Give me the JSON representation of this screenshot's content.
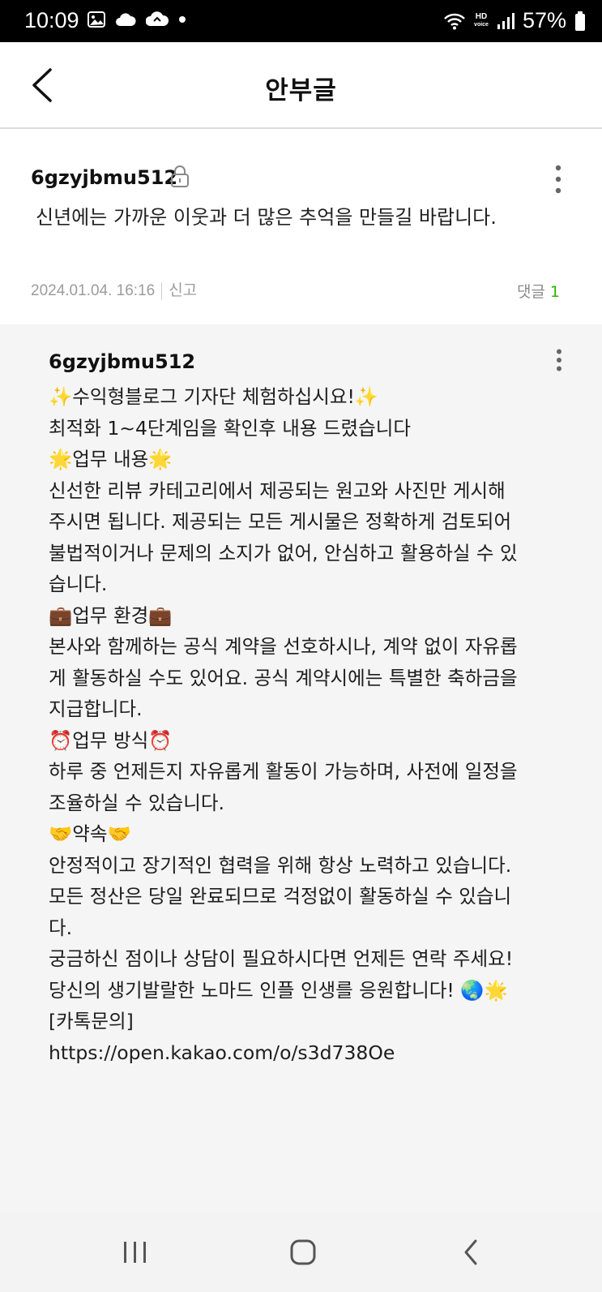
{
  "status_bar": {
    "time": "10:09",
    "battery": "57%",
    "hd_top": "HD",
    "hd_bottom": "voice"
  },
  "header": {
    "title": "안부글"
  },
  "post": {
    "author": "6gzyjbmu512",
    "text": "신년에는 가까운 이웃과 더 많은 추억을 만들길 바랍니다.",
    "date": "2024.01.04. 16:16",
    "report_label": "신고",
    "comments_label": "댓글",
    "comments_count": "1"
  },
  "reply": {
    "author": "6gzyjbmu512",
    "lines": [
      "✨수익형블로그 기자단 체험하십시요!✨",
      "최적화 1~4단계임을 확인후 내용 드렸습니다",
      "",
      "🌟업무 내용🌟",
      "신선한 리뷰 카테고리에서 제공되는 원고와 사진만 게시해",
      "주시면 됩니다. 제공되는 모든 게시물은 정확하게 검토되어",
      "불법적이거나 문제의 소지가 없어, 안심하고 활용하실 수 있",
      "습니다.",
      "",
      "💼업무 환경💼",
      "본사와 함께하는 공식 계약을 선호하시나, 계약 없이 자유롭",
      "게 활동하실 수도 있어요. 공식 계약시에는 특별한 축하금을",
      "지급합니다.",
      "",
      "⏰업무 방식⏰",
      "하루 중 언제든지 자유롭게 활동이 가능하며, 사전에 일정을",
      "조율하실 수 있습니다.",
      "",
      "🤝약속🤝",
      "안정적이고 장기적인 협력을 위해 항상 노력하고 있습니다.",
      "모든 정산은 당일 완료되므로 걱정없이 활동하실 수 있습니",
      "다.",
      "",
      "궁금하신 점이나 상담이 필요하시다면 언제든 연락 주세요!",
      "당신의 생기발랄한 노마드 인플 인생를 응원합니다! 🌏🌟",
      "[카톡문의]",
      "https://open.kakao.com/o/s3d738Oe"
    ]
  },
  "icons": {
    "back": "back-arrow-icon",
    "lock": "lock-icon",
    "more": "more-vertical-icon",
    "recents": "recents-icon",
    "home": "home-icon",
    "nav_back": "nav-back-icon"
  },
  "colors": {
    "accent_green": "#2db400",
    "reply_bg": "#f5f5f5",
    "meta_gray": "#9c9c9c"
  }
}
